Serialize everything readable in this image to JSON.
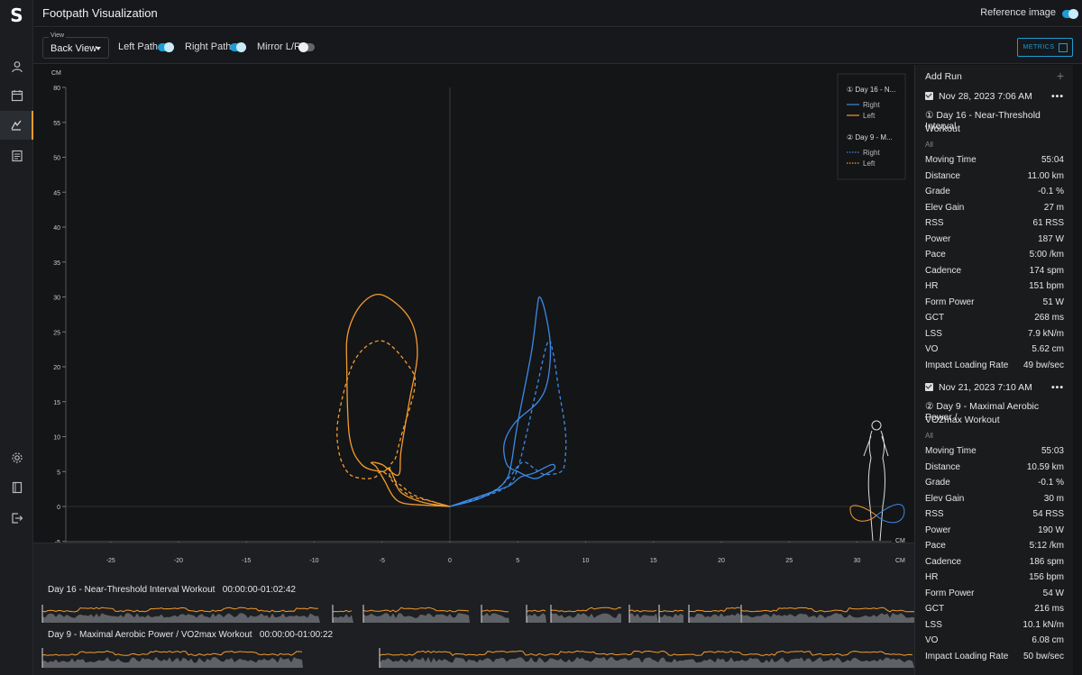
{
  "header": {
    "title": "Footpath Visualization",
    "reference_image_label": "Reference image",
    "reference_image_on": true
  },
  "toolbar": {
    "view_label": "View",
    "view_value": "Back View",
    "left_path_label": "Left Path",
    "left_path_on": true,
    "right_path_label": "Right Path",
    "right_path_on": true,
    "mirror_label": "Mirror L/R",
    "mirror_on": false,
    "metrics_label": "METRICS"
  },
  "sidebar": {
    "logo": "S",
    "items": [
      {
        "icon": "user-icon"
      },
      {
        "icon": "calendar-icon"
      },
      {
        "icon": "footpath-icon",
        "active": true
      },
      {
        "icon": "report-icon"
      },
      {
        "icon": "gear-icon"
      },
      {
        "icon": "book-icon"
      },
      {
        "icon": "logout-icon"
      }
    ]
  },
  "colors": {
    "right": "#3b8be8",
    "left": "#f39b2e",
    "accent": "#1f9bd6"
  },
  "chart_data": {
    "type": "line",
    "xlabel": "CM",
    "ylabel": "CM",
    "xlim": [
      -28,
      32
    ],
    "ylim": [
      -5,
      80
    ],
    "xticks": [
      -25,
      -20,
      -15,
      -10,
      -5,
      0,
      5,
      10,
      15,
      20,
      25,
      30
    ],
    "yticks": [
      80,
      55,
      50,
      45,
      40,
      35,
      30,
      25,
      20,
      15,
      10,
      5,
      0,
      -5
    ],
    "legend": [
      {
        "group": "① Day 16 - N...",
        "entries": [
          {
            "name": "Right",
            "style": "solid",
            "color": "#3b8be8"
          },
          {
            "name": "Left",
            "style": "solid",
            "color": "#f39b2e"
          }
        ]
      },
      {
        "group": "② Day 9 - M...",
        "entries": [
          {
            "name": "Right",
            "style": "dotted",
            "color": "#3b8be8"
          },
          {
            "name": "Left",
            "style": "dotted",
            "color": "#f39b2e"
          }
        ]
      }
    ],
    "legend_placement": "top-right",
    "series": [
      {
        "name": "Day 16 Right",
        "style": "solid",
        "color": "#3b8be8",
        "points": [
          [
            0,
            0
          ],
          [
            2,
            1
          ],
          [
            3.5,
            2.5
          ],
          [
            4.2,
            4
          ],
          [
            4.4,
            5
          ],
          [
            4.6,
            7
          ],
          [
            5,
            12
          ],
          [
            6,
            22
          ],
          [
            6.4,
            28
          ],
          [
            6.6,
            30
          ],
          [
            7,
            28
          ],
          [
            7.4,
            23
          ],
          [
            7.2,
            18
          ],
          [
            6.5,
            15
          ],
          [
            4.8,
            12
          ],
          [
            4,
            9
          ],
          [
            4.2,
            6
          ],
          [
            5,
            5
          ],
          [
            6.2,
            4
          ],
          [
            7,
            4.6
          ],
          [
            7.7,
            5.4
          ],
          [
            7.5,
            6
          ],
          [
            6.2,
            4.8
          ],
          [
            5.2,
            4.2
          ],
          [
            4.4,
            3
          ],
          [
            3,
            2
          ],
          [
            1.5,
            1
          ],
          [
            0,
            0
          ]
        ]
      },
      {
        "name": "Day 16 Left",
        "style": "solid",
        "color": "#f39b2e",
        "points": [
          [
            0,
            0
          ],
          [
            -2,
            0.2
          ],
          [
            -3.5,
            0.5
          ],
          [
            -4.2,
            1.5
          ],
          [
            -4.8,
            3.6
          ],
          [
            -5.4,
            5.6
          ],
          [
            -5.8,
            6.3
          ],
          [
            -5,
            6
          ],
          [
            -3.8,
            4.5
          ],
          [
            -3.6,
            8
          ],
          [
            -3,
            15
          ],
          [
            -2.4,
            22
          ],
          [
            -3,
            27
          ],
          [
            -5,
            30.3
          ],
          [
            -6.5,
            29
          ],
          [
            -7.5,
            25
          ],
          [
            -7.6,
            20
          ],
          [
            -7.4,
            10
          ],
          [
            -6.5,
            6
          ],
          [
            -5,
            5
          ],
          [
            -4.5,
            5.5
          ],
          [
            -4.1,
            4
          ],
          [
            -3.6,
            2
          ],
          [
            -2,
            0.6
          ],
          [
            0,
            0
          ]
        ]
      },
      {
        "name": "Day 9 Right",
        "style": "dotted",
        "color": "#3b8be8",
        "points": [
          [
            0,
            0
          ],
          [
            2.5,
            1.4
          ],
          [
            4.3,
            3
          ],
          [
            5,
            5.5
          ],
          [
            5.6,
            10
          ],
          [
            6.4,
            17
          ],
          [
            7.2,
            23.5
          ],
          [
            7.6,
            22
          ],
          [
            8,
            17
          ],
          [
            8.5,
            11
          ],
          [
            8.5,
            7
          ],
          [
            8.2,
            5
          ],
          [
            7,
            4.6
          ],
          [
            6.3,
            5.3
          ],
          [
            5.6,
            6.3
          ],
          [
            5.1,
            6
          ],
          [
            4.3,
            4
          ],
          [
            3,
            2
          ],
          [
            0,
            0
          ]
        ]
      },
      {
        "name": "Day 9 Left",
        "style": "dotted",
        "color": "#f39b2e",
        "points": [
          [
            0,
            0
          ],
          [
            -1.5,
            0.8
          ],
          [
            -3,
            1.6
          ],
          [
            -4.3,
            3.8
          ],
          [
            -4.4,
            5.8
          ],
          [
            -4,
            7
          ],
          [
            -3.6,
            10
          ],
          [
            -2.6,
            17
          ],
          [
            -3,
            20
          ],
          [
            -5,
            23.7
          ],
          [
            -7,
            21
          ],
          [
            -8.2,
            13
          ],
          [
            -8.2,
            8
          ],
          [
            -7.5,
            4.8
          ],
          [
            -6.4,
            4
          ],
          [
            -5.5,
            4.2
          ],
          [
            -5,
            5
          ],
          [
            -3.6,
            3
          ],
          [
            -2.5,
            1.5
          ],
          [
            0,
            0
          ]
        ]
      }
    ]
  },
  "rpanel": {
    "add_run": "Add Run",
    "runs": [
      {
        "date": "Nov 28, 2023 7:06 AM",
        "name_line1": "① Day 16 - Near-Threshold Interval",
        "name_line2": "Workout",
        "all": "All",
        "metrics": [
          [
            "Moving Time",
            "55:04"
          ],
          [
            "Distance",
            "11.00 km"
          ],
          [
            "Grade",
            "-0.1 %"
          ],
          [
            "Elev Gain",
            "27 m"
          ],
          [
            "RSS",
            "61 RSS"
          ],
          [
            "Power",
            "187 W"
          ],
          [
            "Pace",
            "5:00 /km"
          ],
          [
            "Cadence",
            "174 spm"
          ],
          [
            "HR",
            "151 bpm"
          ],
          [
            "Form Power",
            "51 W"
          ],
          [
            "GCT",
            "268 ms"
          ],
          [
            "LSS",
            "7.9 kN/m"
          ],
          [
            "VO",
            "5.62 cm"
          ],
          [
            "Impact Loading Rate",
            "49 bw/sec"
          ]
        ]
      },
      {
        "date": "Nov 21, 2023 7:10 AM",
        "name_line1": "② Day 9 - Maximal Aerobic Power /",
        "name_line2": "VO2max Workout",
        "all": "All",
        "metrics": [
          [
            "Moving Time",
            "55:03"
          ],
          [
            "Distance",
            "10.59 km"
          ],
          [
            "Grade",
            "-0.1 %"
          ],
          [
            "Elev Gain",
            "30 m"
          ],
          [
            "RSS",
            "54 RSS"
          ],
          [
            "Power",
            "190 W"
          ],
          [
            "Pace",
            "5:12 /km"
          ],
          [
            "Cadence",
            "186 spm"
          ],
          [
            "HR",
            "156 bpm"
          ],
          [
            "Form Power",
            "54 W"
          ],
          [
            "GCT",
            "216 ms"
          ],
          [
            "LSS",
            "10.1 kN/m"
          ],
          [
            "VO",
            "6.08 cm"
          ],
          [
            "Impact Loading Rate",
            "50 bw/sec"
          ]
        ]
      }
    ]
  },
  "timeline": [
    {
      "label": "Day 16 - Near-Threshold Interval Workout   00:00:00-01:02:42"
    },
    {
      "label": "Day 9 - Maximal Aerobic Power / VO2max Workout   00:00:00-01:00:22"
    }
  ]
}
